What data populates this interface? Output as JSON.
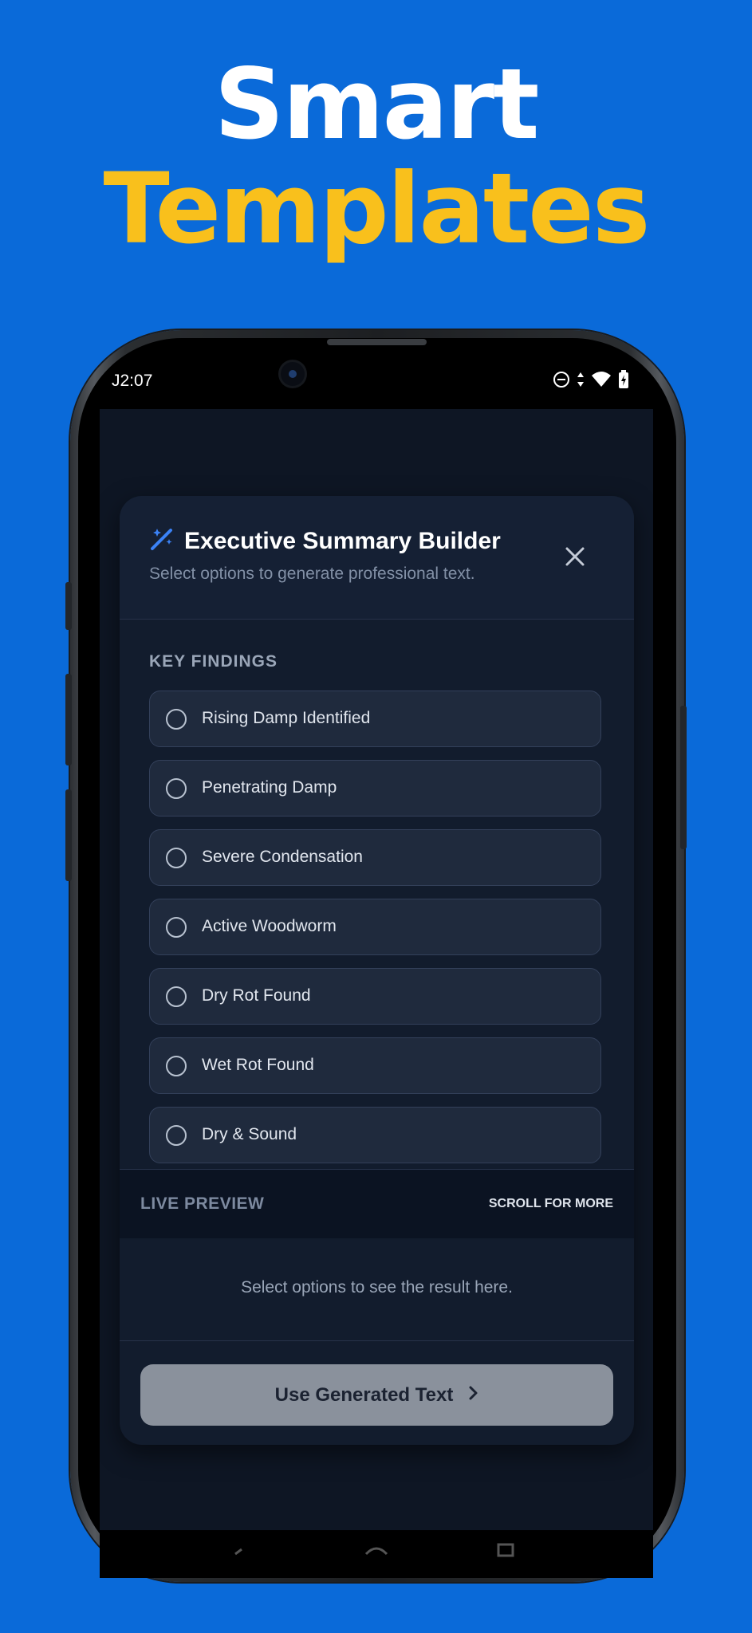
{
  "hero": {
    "line1": "Smart",
    "line2": "Templates"
  },
  "colors": {
    "background": "#0a6ad9",
    "accent_yellow": "#f9c01c",
    "dialog_bg": "#121c2d",
    "option_bg": "#1f2a3d",
    "button_disabled": "#8a919c",
    "icon_blue": "#3b82f6"
  },
  "status_bar": {
    "time": "J2:07",
    "icons": [
      "do-not-disturb-icon",
      "data-arrows-icon",
      "wifi-icon",
      "battery-charging-icon"
    ]
  },
  "dialog": {
    "title": "Executive Summary Builder",
    "title_icon": "magic-wand-icon",
    "subtitle": "Select options to generate professional text.",
    "close_icon": "close-icon",
    "section_label": "KEY FINDINGS",
    "options": [
      {
        "label": "Rising Damp Identified",
        "selected": false
      },
      {
        "label": "Penetrating Damp",
        "selected": false
      },
      {
        "label": "Severe Condensation",
        "selected": false
      },
      {
        "label": "Active Woodworm",
        "selected": false
      },
      {
        "label": "Dry Rot Found",
        "selected": false
      },
      {
        "label": "Wet Rot Found",
        "selected": false
      },
      {
        "label": "Dry & Sound",
        "selected": false
      }
    ],
    "preview": {
      "label": "LIVE PREVIEW",
      "scroll_hint": "SCROLL FOR MORE",
      "empty_text": "Select options to see the result here."
    },
    "primary_button": {
      "label": "Use Generated Text",
      "icon": "chevron-right-icon"
    }
  }
}
